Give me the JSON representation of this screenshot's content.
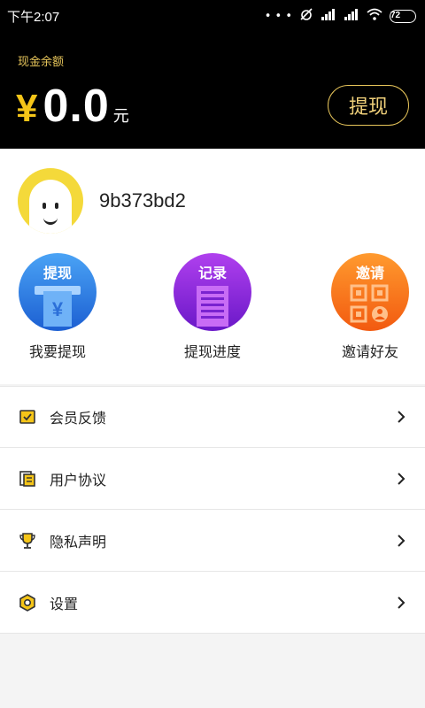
{
  "status_bar": {
    "time": "下午2:07",
    "dots": "• • •",
    "battery": "72"
  },
  "balance": {
    "label": "现金余额",
    "currency_symbol": "¥",
    "amount": "0.0",
    "unit": "元",
    "withdraw_button": "提现"
  },
  "profile": {
    "username": "9b373bd2"
  },
  "shortcuts": [
    {
      "tag": "提现",
      "label": "我要提现",
      "icon": "withdraw-icon",
      "color": "#2f7de6"
    },
    {
      "tag": "记录",
      "label": "提现进度",
      "icon": "record-icon",
      "color": "#8a2ddc"
    },
    {
      "tag": "邀请",
      "label": "邀请好友",
      "icon": "invite-qr-icon",
      "color": "#f77a1e"
    }
  ],
  "menu": [
    {
      "label": "会员反馈",
      "icon": "feedback-icon"
    },
    {
      "label": "用户协议",
      "icon": "document-icon"
    },
    {
      "label": "隐私声明",
      "icon": "trophy-icon"
    },
    {
      "label": "设置",
      "icon": "settings-icon"
    }
  ],
  "colors": {
    "header_bg": "#000000",
    "accent_gold": "#f5c518",
    "button_border": "#e8c65b"
  }
}
